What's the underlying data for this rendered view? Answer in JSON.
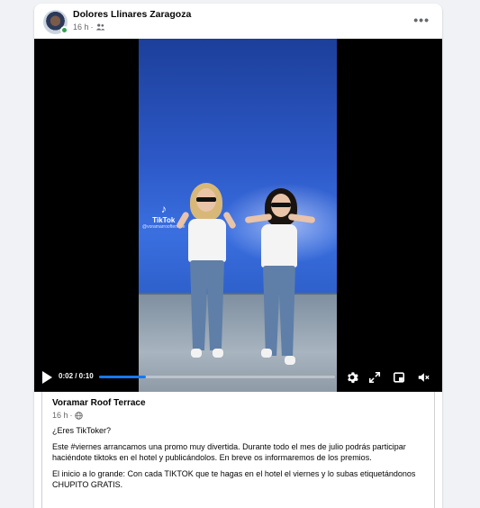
{
  "post": {
    "author": "Dolores Llinares Zaragoza",
    "time": "16 h",
    "separator": "·",
    "audience_icon": "friends-icon",
    "more_label": "•••"
  },
  "video": {
    "overlay_brand": "TikTok",
    "overlay_handle": "@voramarroofterrace",
    "time_display": "0:02 / 0:10",
    "progress": 0.2,
    "colors": {
      "progress": "#1877f2",
      "background": "#000000"
    }
  },
  "shared_post": {
    "page_name": "Voramar Roof Terrace",
    "time": "16 h",
    "separator": "·",
    "audience_icon": "globe-icon",
    "paragraphs": [
      "¿Eres TikToker?",
      "Este #viernes arrancamos una promo muy divertida. Durante todo el mes de julio podrás participar haciéndote tiktoks en el hotel y publicándolos. En breve os informaremos de los premios.",
      "El inicio a lo grande: Con cada TIKTOK que te hagas en el hotel el viernes y lo subas etiquetándonos CHUPITO GRATIS."
    ]
  }
}
